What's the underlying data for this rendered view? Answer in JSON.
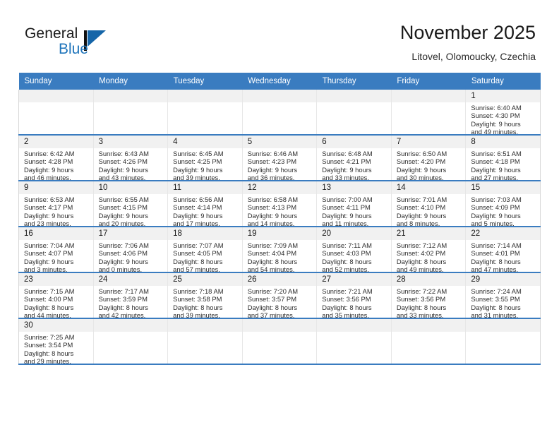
{
  "brand": {
    "name_part1": "General",
    "name_part2": "Blue",
    "accent_color": "#1565a8",
    "logo_icon": "triangle-flag-logo"
  },
  "header": {
    "title": "November 2025",
    "subtitle": "Litovel, Olomoucky, Czechia"
  },
  "calendar": {
    "header_bg": "#3a7cc0",
    "weekday_headers": [
      "Sunday",
      "Monday",
      "Tuesday",
      "Wednesday",
      "Thursday",
      "Friday",
      "Saturday"
    ],
    "weeks": [
      [
        {
          "day": "",
          "lines": []
        },
        {
          "day": "",
          "lines": []
        },
        {
          "day": "",
          "lines": []
        },
        {
          "day": "",
          "lines": []
        },
        {
          "day": "",
          "lines": []
        },
        {
          "day": "",
          "lines": []
        },
        {
          "day": "1",
          "lines": [
            "Sunrise: 6:40 AM",
            "Sunset: 4:30 PM",
            "Daylight: 9 hours",
            "and 49 minutes."
          ]
        }
      ],
      [
        {
          "day": "2",
          "lines": [
            "Sunrise: 6:42 AM",
            "Sunset: 4:28 PM",
            "Daylight: 9 hours",
            "and 46 minutes."
          ]
        },
        {
          "day": "3",
          "lines": [
            "Sunrise: 6:43 AM",
            "Sunset: 4:26 PM",
            "Daylight: 9 hours",
            "and 43 minutes."
          ]
        },
        {
          "day": "4",
          "lines": [
            "Sunrise: 6:45 AM",
            "Sunset: 4:25 PM",
            "Daylight: 9 hours",
            "and 39 minutes."
          ]
        },
        {
          "day": "5",
          "lines": [
            "Sunrise: 6:46 AM",
            "Sunset: 4:23 PM",
            "Daylight: 9 hours",
            "and 36 minutes."
          ]
        },
        {
          "day": "6",
          "lines": [
            "Sunrise: 6:48 AM",
            "Sunset: 4:21 PM",
            "Daylight: 9 hours",
            "and 33 minutes."
          ]
        },
        {
          "day": "7",
          "lines": [
            "Sunrise: 6:50 AM",
            "Sunset: 4:20 PM",
            "Daylight: 9 hours",
            "and 30 minutes."
          ]
        },
        {
          "day": "8",
          "lines": [
            "Sunrise: 6:51 AM",
            "Sunset: 4:18 PM",
            "Daylight: 9 hours",
            "and 27 minutes."
          ]
        }
      ],
      [
        {
          "day": "9",
          "lines": [
            "Sunrise: 6:53 AM",
            "Sunset: 4:17 PM",
            "Daylight: 9 hours",
            "and 23 minutes."
          ]
        },
        {
          "day": "10",
          "lines": [
            "Sunrise: 6:55 AM",
            "Sunset: 4:15 PM",
            "Daylight: 9 hours",
            "and 20 minutes."
          ]
        },
        {
          "day": "11",
          "lines": [
            "Sunrise: 6:56 AM",
            "Sunset: 4:14 PM",
            "Daylight: 9 hours",
            "and 17 minutes."
          ]
        },
        {
          "day": "12",
          "lines": [
            "Sunrise: 6:58 AM",
            "Sunset: 4:13 PM",
            "Daylight: 9 hours",
            "and 14 minutes."
          ]
        },
        {
          "day": "13",
          "lines": [
            "Sunrise: 7:00 AM",
            "Sunset: 4:11 PM",
            "Daylight: 9 hours",
            "and 11 minutes."
          ]
        },
        {
          "day": "14",
          "lines": [
            "Sunrise: 7:01 AM",
            "Sunset: 4:10 PM",
            "Daylight: 9 hours",
            "and 8 minutes."
          ]
        },
        {
          "day": "15",
          "lines": [
            "Sunrise: 7:03 AM",
            "Sunset: 4:09 PM",
            "Daylight: 9 hours",
            "and 5 minutes."
          ]
        }
      ],
      [
        {
          "day": "16",
          "lines": [
            "Sunrise: 7:04 AM",
            "Sunset: 4:07 PM",
            "Daylight: 9 hours",
            "and 3 minutes."
          ]
        },
        {
          "day": "17",
          "lines": [
            "Sunrise: 7:06 AM",
            "Sunset: 4:06 PM",
            "Daylight: 9 hours",
            "and 0 minutes."
          ]
        },
        {
          "day": "18",
          "lines": [
            "Sunrise: 7:07 AM",
            "Sunset: 4:05 PM",
            "Daylight: 8 hours",
            "and 57 minutes."
          ]
        },
        {
          "day": "19",
          "lines": [
            "Sunrise: 7:09 AM",
            "Sunset: 4:04 PM",
            "Daylight: 8 hours",
            "and 54 minutes."
          ]
        },
        {
          "day": "20",
          "lines": [
            "Sunrise: 7:11 AM",
            "Sunset: 4:03 PM",
            "Daylight: 8 hours",
            "and 52 minutes."
          ]
        },
        {
          "day": "21",
          "lines": [
            "Sunrise: 7:12 AM",
            "Sunset: 4:02 PM",
            "Daylight: 8 hours",
            "and 49 minutes."
          ]
        },
        {
          "day": "22",
          "lines": [
            "Sunrise: 7:14 AM",
            "Sunset: 4:01 PM",
            "Daylight: 8 hours",
            "and 47 minutes."
          ]
        }
      ],
      [
        {
          "day": "23",
          "lines": [
            "Sunrise: 7:15 AM",
            "Sunset: 4:00 PM",
            "Daylight: 8 hours",
            "and 44 minutes."
          ]
        },
        {
          "day": "24",
          "lines": [
            "Sunrise: 7:17 AM",
            "Sunset: 3:59 PM",
            "Daylight: 8 hours",
            "and 42 minutes."
          ]
        },
        {
          "day": "25",
          "lines": [
            "Sunrise: 7:18 AM",
            "Sunset: 3:58 PM",
            "Daylight: 8 hours",
            "and 39 minutes."
          ]
        },
        {
          "day": "26",
          "lines": [
            "Sunrise: 7:20 AM",
            "Sunset: 3:57 PM",
            "Daylight: 8 hours",
            "and 37 minutes."
          ]
        },
        {
          "day": "27",
          "lines": [
            "Sunrise: 7:21 AM",
            "Sunset: 3:56 PM",
            "Daylight: 8 hours",
            "and 35 minutes."
          ]
        },
        {
          "day": "28",
          "lines": [
            "Sunrise: 7:22 AM",
            "Sunset: 3:56 PM",
            "Daylight: 8 hours",
            "and 33 minutes."
          ]
        },
        {
          "day": "29",
          "lines": [
            "Sunrise: 7:24 AM",
            "Sunset: 3:55 PM",
            "Daylight: 8 hours",
            "and 31 minutes."
          ]
        }
      ],
      [
        {
          "day": "30",
          "lines": [
            "Sunrise: 7:25 AM",
            "Sunset: 3:54 PM",
            "Daylight: 8 hours",
            "and 29 minutes."
          ]
        },
        {
          "day": "",
          "lines": []
        },
        {
          "day": "",
          "lines": []
        },
        {
          "day": "",
          "lines": []
        },
        {
          "day": "",
          "lines": []
        },
        {
          "day": "",
          "lines": []
        },
        {
          "day": "",
          "lines": []
        }
      ]
    ]
  }
}
